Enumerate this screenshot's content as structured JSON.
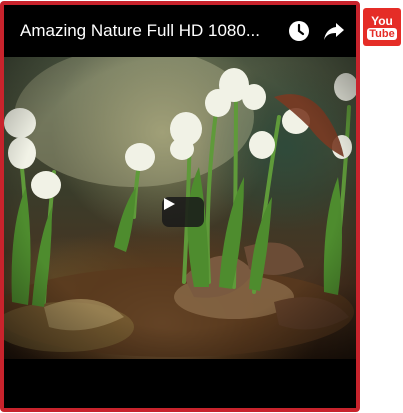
{
  "video": {
    "title": "Amazing Nature Full HD 1080...",
    "icons": [
      "clock-icon",
      "share-icon",
      "play-icon"
    ]
  },
  "logo": {
    "line1": "You",
    "line2": "Tube",
    "brand_color": "#e52d27"
  },
  "colors": {
    "frame_border": "#c8232c",
    "player_background": "#000000"
  }
}
